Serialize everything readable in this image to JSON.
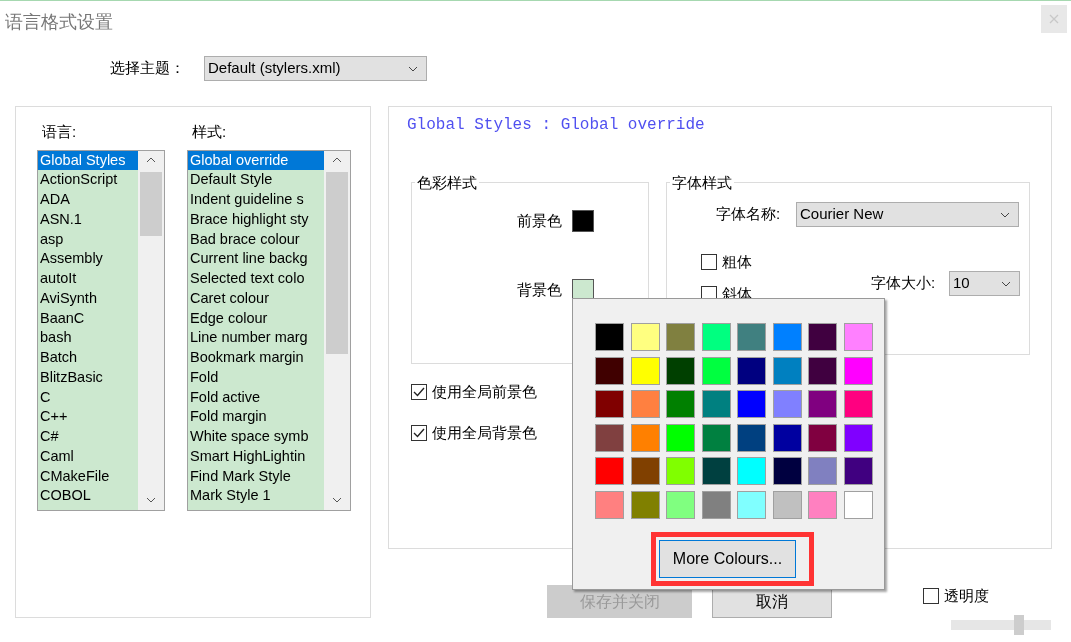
{
  "window": {
    "title": "语言格式设置"
  },
  "theme": {
    "label": "选择主题：",
    "value": "Default (stylers.xml)"
  },
  "languages": {
    "label": "语言:",
    "items": [
      {
        "text": "Global Styles",
        "selected": true
      },
      {
        "text": "ActionScript",
        "selected": false
      },
      {
        "text": "ADA",
        "selected": false
      },
      {
        "text": "ASN.1",
        "selected": false
      },
      {
        "text": "asp",
        "selected": false
      },
      {
        "text": "Assembly",
        "selected": false
      },
      {
        "text": "autoIt",
        "selected": false
      },
      {
        "text": "AviSynth",
        "selected": false
      },
      {
        "text": "BaanC",
        "selected": false
      },
      {
        "text": "bash",
        "selected": false
      },
      {
        "text": "Batch",
        "selected": false
      },
      {
        "text": "BlitzBasic",
        "selected": false
      },
      {
        "text": "C",
        "selected": false
      },
      {
        "text": "C++",
        "selected": false
      },
      {
        "text": "C#",
        "selected": false
      },
      {
        "text": "Caml",
        "selected": false
      },
      {
        "text": "CMakeFile",
        "selected": false
      },
      {
        "text": "COBOL",
        "selected": false
      }
    ]
  },
  "styles": {
    "label": "样式:",
    "items": [
      {
        "text": "Global override",
        "selected": true
      },
      {
        "text": "Default Style",
        "selected": false
      },
      {
        "text": "Indent guideline s",
        "selected": false
      },
      {
        "text": "Brace highlight sty",
        "selected": false
      },
      {
        "text": "Bad brace colour",
        "selected": false
      },
      {
        "text": "Current line backg",
        "selected": false
      },
      {
        "text": "Selected text colo",
        "selected": false
      },
      {
        "text": "Caret colour",
        "selected": false
      },
      {
        "text": "Edge colour",
        "selected": false
      },
      {
        "text": "Line number marg",
        "selected": false
      },
      {
        "text": "Bookmark margin",
        "selected": false
      },
      {
        "text": "Fold",
        "selected": false
      },
      {
        "text": "Fold active",
        "selected": false
      },
      {
        "text": "Fold margin",
        "selected": false
      },
      {
        "text": "White space symb",
        "selected": false
      },
      {
        "text": "Smart HighLightin",
        "selected": false
      },
      {
        "text": "Find Mark Style",
        "selected": false
      },
      {
        "text": "Mark Style 1",
        "selected": false
      }
    ]
  },
  "style_panel": {
    "title": "Global Styles : Global override",
    "colour_group": {
      "legend": "色彩样式",
      "foreground": {
        "label": "前景色",
        "color": "#000000"
      },
      "background": {
        "label": "背景色",
        "color": "#cce8cf"
      }
    },
    "font_group": {
      "legend": "字体样式",
      "font_name": {
        "label": "字体名称:",
        "value": "Courier New"
      },
      "bold": {
        "label": "粗体",
        "checked": false
      },
      "italic": {
        "label": "斜体",
        "checked": false
      },
      "font_size": {
        "label": "字体大小:",
        "value": "10"
      }
    },
    "global_options": [
      {
        "label": "使用全局前景色",
        "checked": true
      },
      {
        "label": "使用全局背景色",
        "checked": true
      }
    ]
  },
  "buttons": [
    {
      "label": "保存并关闭",
      "disabled": true
    },
    {
      "label": "取消",
      "disabled": false
    }
  ],
  "transparency": {
    "label": "透明度",
    "checked": false,
    "level": 0.7
  },
  "colour_popup": {
    "more_button": "More Colours...",
    "highlighted": true,
    "palette": [
      {
        "color": "#000000"
      },
      {
        "color": "#ffff80"
      },
      {
        "color": "#808040"
      },
      {
        "color": "#00ff80"
      },
      {
        "color": "#408080"
      },
      {
        "color": "#0080ff"
      },
      {
        "color": "#400040"
      },
      {
        "color": "#ff80ff"
      },
      {
        "color": "#400000"
      },
      {
        "color": "#ffff00"
      },
      {
        "color": "#004000"
      },
      {
        "color": "#00ff40"
      },
      {
        "color": "#000080"
      },
      {
        "color": "#0080c0"
      },
      {
        "color": "#400040"
      },
      {
        "color": "#ff00ff"
      },
      {
        "color": "#800000"
      },
      {
        "color": "#ff8040"
      },
      {
        "color": "#008000"
      },
      {
        "color": "#008080"
      },
      {
        "color": "#0000ff"
      },
      {
        "color": "#8080ff"
      },
      {
        "color": "#800080"
      },
      {
        "color": "#ff0080"
      },
      {
        "color": "#804040"
      },
      {
        "color": "#ff8000"
      },
      {
        "color": "#00ff00"
      },
      {
        "color": "#008040"
      },
      {
        "color": "#004080"
      },
      {
        "color": "#0000a0"
      },
      {
        "color": "#800040"
      },
      {
        "color": "#8000ff"
      },
      {
        "color": "#ff0000"
      },
      {
        "color": "#804000"
      },
      {
        "color": "#80ff00"
      },
      {
        "color": "#004040"
      },
      {
        "color": "#00ffff"
      },
      {
        "color": "#000040"
      },
      {
        "color": "#8080c0"
      },
      {
        "color": "#400080"
      },
      {
        "color": "#ff8080"
      },
      {
        "color": "#808000"
      },
      {
        "color": "#80ff80"
      },
      {
        "color": "#808080"
      },
      {
        "color": "#80ffff"
      },
      {
        "color": "#c0c0c0"
      },
      {
        "color": "#ff80c0"
      },
      {
        "color": "#ffffff"
      }
    ]
  }
}
